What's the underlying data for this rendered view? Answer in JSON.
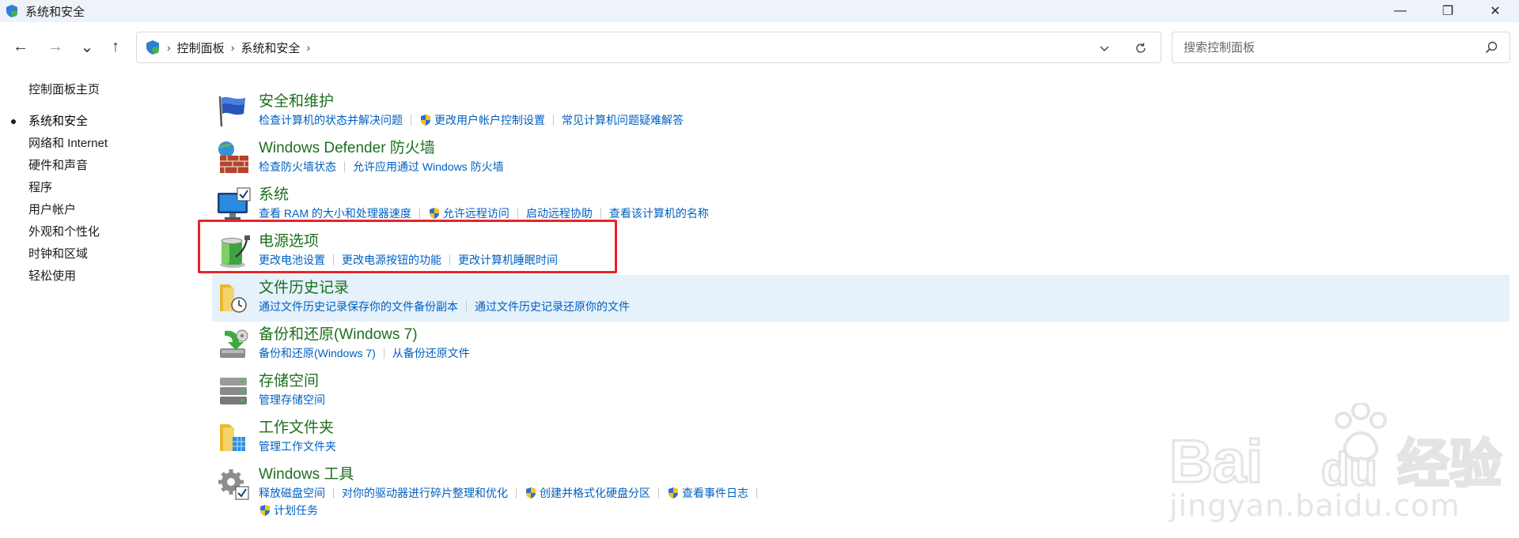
{
  "window": {
    "title": "系统和安全",
    "controls": {
      "minimize": "—",
      "restore": "❐",
      "close": "✕"
    }
  },
  "nav": {
    "back": "←",
    "forward": "→",
    "recent": "⌄",
    "up": "↑",
    "breadcrumb": [
      "控制面板",
      "系统和安全"
    ],
    "search_placeholder": "搜索控制面板"
  },
  "leftnav": {
    "home": "控制面板主页",
    "items": [
      "系统和安全",
      "网络和 Internet",
      "硬件和声音",
      "程序",
      "用户帐户",
      "外观和个性化",
      "时钟和区域",
      "轻松使用"
    ],
    "active_index": 0
  },
  "categories": [
    {
      "title": "安全和维护",
      "icon": "flag-icon",
      "links": [
        {
          "text": "检查计算机的状态并解决问题",
          "shield": false
        },
        {
          "text": "更改用户帐户控制设置",
          "shield": true
        },
        {
          "text": "常见计算机问题疑难解答",
          "shield": false
        }
      ]
    },
    {
      "title": "Windows Defender 防火墙",
      "icon": "firewall-icon",
      "links": [
        {
          "text": "检查防火墙状态",
          "shield": false
        },
        {
          "text": "允许应用通过 Windows 防火墙",
          "shield": false
        }
      ]
    },
    {
      "title": "系统",
      "icon": "monitor-icon",
      "links": [
        {
          "text": "查看 RAM 的大小和处理器速度",
          "shield": false
        },
        {
          "text": "允许远程访问",
          "shield": true
        },
        {
          "text": "启动远程协助",
          "shield": false
        },
        {
          "text": "查看该计算机的名称",
          "shield": false
        }
      ]
    },
    {
      "title": "电源选项",
      "icon": "battery-icon",
      "links": [
        {
          "text": "更改电池设置",
          "shield": false
        },
        {
          "text": "更改电源按钮的功能",
          "shield": false
        },
        {
          "text": "更改计算机睡眠时间",
          "shield": false
        }
      ]
    },
    {
      "title": "文件历史记录",
      "icon": "file-history-icon",
      "links": [
        {
          "text": "通过文件历史记录保存你的文件备份副本",
          "shield": false
        },
        {
          "text": "通过文件历史记录还原你的文件",
          "shield": false
        }
      ]
    },
    {
      "title": "备份和还原(Windows 7)",
      "icon": "backup-icon",
      "links": [
        {
          "text": "备份和还原(Windows 7)",
          "shield": false
        },
        {
          "text": "从备份还原文件",
          "shield": false
        }
      ]
    },
    {
      "title": "存储空间",
      "icon": "storage-icon",
      "links": [
        {
          "text": "管理存储空间",
          "shield": false
        }
      ]
    },
    {
      "title": "工作文件夹",
      "icon": "work-folders-icon",
      "links": [
        {
          "text": "管理工作文件夹",
          "shield": false
        }
      ]
    },
    {
      "title": "Windows 工具",
      "icon": "tools-icon",
      "links": [
        {
          "text": "释放磁盘空间",
          "shield": false
        },
        {
          "text": "对你的驱动器进行碎片整理和优化",
          "shield": false
        },
        {
          "text": "创建并格式化硬盘分区",
          "shield": true
        },
        {
          "text": "查看事件日志",
          "shield": true
        }
      ],
      "extra_link": {
        "text": "计划任务",
        "shield": true
      }
    }
  ],
  "highlight_index": 4,
  "watermark": {
    "logo": "Baidu经验",
    "url": "jingyan.baidu.com"
  },
  "colors": {
    "title_green": "#1e6e1e",
    "link_blue": "#0060c0",
    "highlight": "#e5f1fb",
    "annotation_red": "#e8242a"
  }
}
